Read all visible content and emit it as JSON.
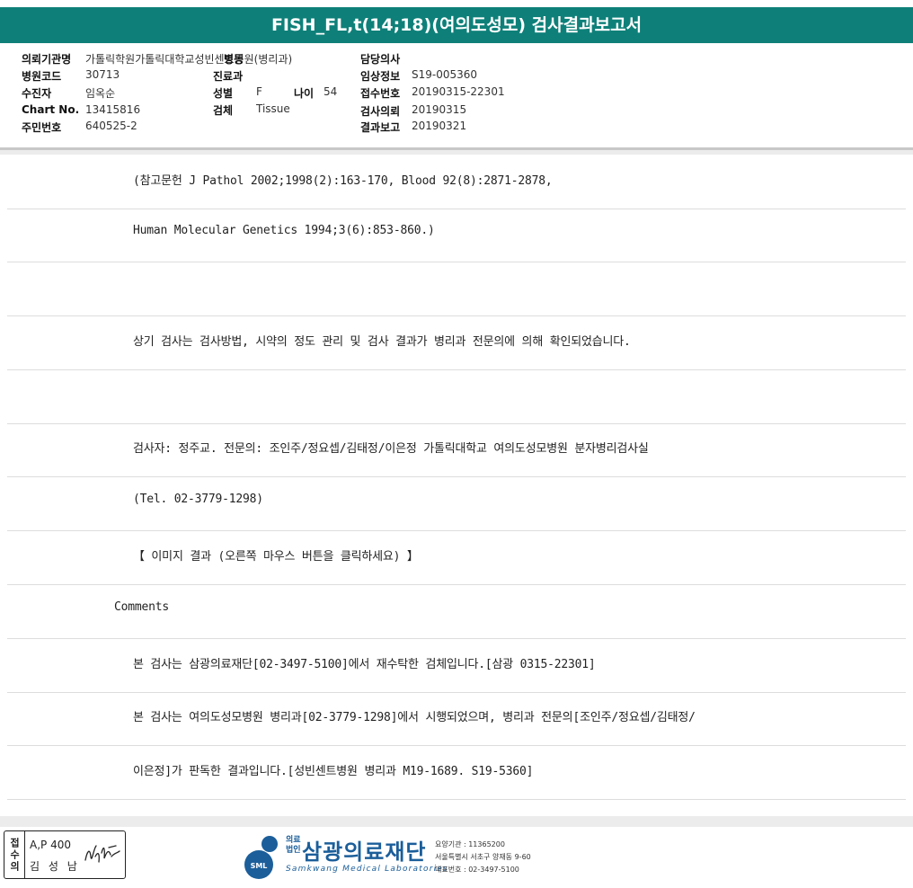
{
  "title": "FISH_FL,t(14;18)(여의도성모) 검사결과보고서",
  "header": {
    "institution_label": "의뢰기관명",
    "institution_value": "가톨릭학원가톨릭대학교성빈센트병원(병리과)",
    "ward_label": "병동",
    "doctor_label": "담당의사",
    "hospital_code_label": "병원코드",
    "hospital_code_value": "30713",
    "dept_label": "진료과",
    "clinical_info_label": "임상정보",
    "clinical_info_value": "S19-005360",
    "patient_label": "수진자",
    "patient_value": "임옥순",
    "sex_label": "성별",
    "sex_value": "F",
    "age_label": "나이",
    "age_value": "54",
    "receipt_no_label": "접수번호",
    "receipt_no_value": "20190315-22301",
    "chart_no_label": "Chart No.",
    "chart_no_value": "13415816",
    "specimen_label": "검체",
    "specimen_value": "Tissue",
    "request_label": "검사의뢰",
    "request_value": "20190315",
    "id_label": "주민번호",
    "id_value": "640525-2",
    "report_label": "결과보고",
    "report_value": "20190321"
  },
  "rows": [
    "(참고문헌 J Pathol 2002;1998(2):163-170, Blood 92(8):2871-2878,",
    "Human Molecular Genetics 1994;3(6):853-860.)",
    "",
    "상기 검사는 검사방법, 시약의 정도 관리 및 검사 결과가 병리과 전문의에 의해 확인되었습니다.",
    "",
    "검사자: 정주교. 전문의: 조인주/정요셉/김태정/이은정 가톨릭대학교 여의도성모병원 분자병리검사실",
    "(Tel. 02-3779-1298)",
    "【 이미지 결과 (오른쪽 마우스 버튼을 클릭하세요) 】",
    "Comments",
    "본 검사는 삼광의료재단[02-3497-5100]에서 재수탁한 검체입니다.[삼광 0315-22301]",
    "본 검사는 여의도성모병원 병리과[02-3779-1298]에서 시행되었으며, 병리과 전문의[조인주/정요셉/김태정/",
    "이은정]가 판독한 결과입니다.[성빈센트병원 병리과 M19-1689. S19-5360]"
  ],
  "footer": {
    "stamp_side": "접수의",
    "stamp_line1": "A,P 400",
    "stamp_line2": "김 성 남",
    "logo_small1": "의료",
    "logo_small2": "법인",
    "logo_name": "삼광의료재단",
    "logo_en": "Samkwang Medical Laboratories",
    "logo_badge": "SML",
    "info1": "요양기관 : 11365200",
    "info2": "서울특별시 서초구 양재동 9-60",
    "info3": "대표번호 : 02-3497-5100"
  },
  "colors": {
    "title_bar": "#0e8079",
    "logo_blue": "#1b5e9a"
  }
}
